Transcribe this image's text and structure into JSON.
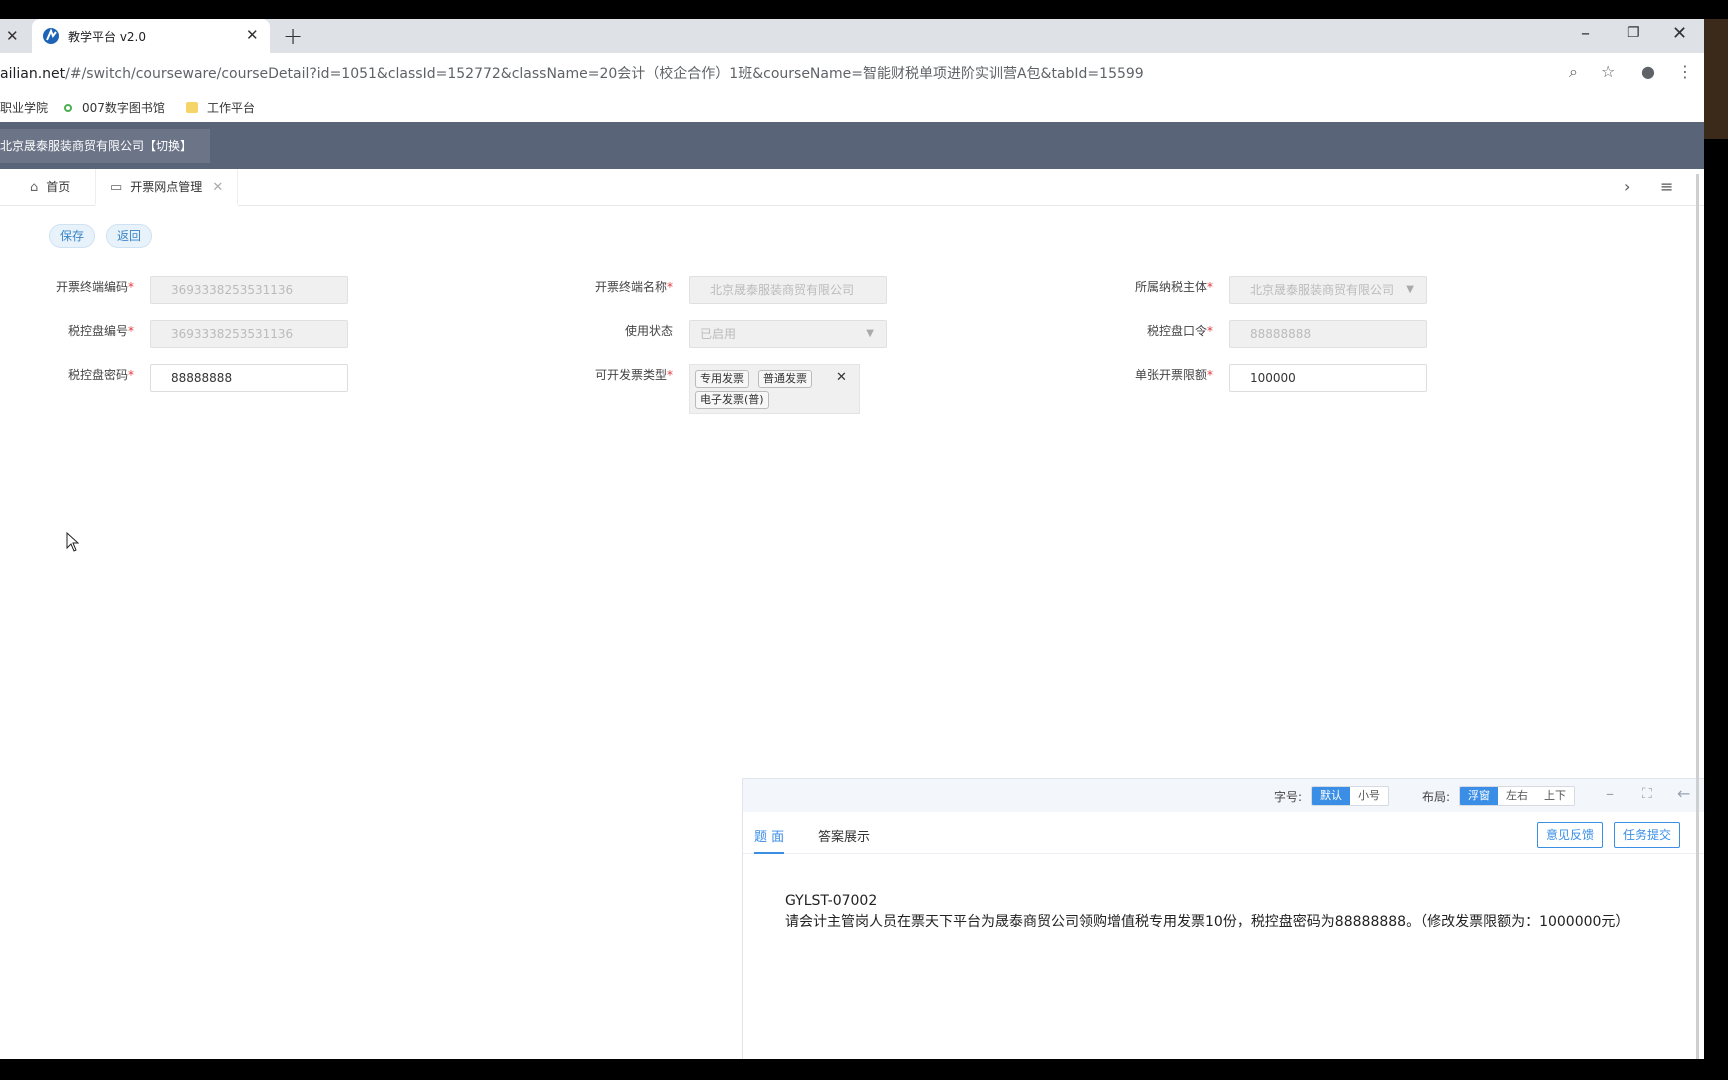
{
  "browser": {
    "tab_title": "教学平台 v2.0",
    "url_host": "ailian.net",
    "url_path": "/#/switch/courseware/courseDetail?id=1051&classId=152772&className=20会计（校企合作）1班&courseName=智能财税单项进阶实训营A包&tabId=15599",
    "bookmarks": [
      "职业学院",
      "007数字图书馆",
      "工作平台"
    ]
  },
  "header": {
    "company": "北京晟泰服装商贸有限公司【切换】"
  },
  "page_tabs": {
    "home": "首页",
    "active": "开票网点管理"
  },
  "actions": {
    "save": "保存",
    "back": "返回"
  },
  "form": {
    "terminal_code_label": "开票终端编码",
    "terminal_code_value": "3693338253531136",
    "terminal_name_label": "开票终端名称",
    "terminal_name_value": "北京晟泰服装商贸有限公司",
    "taxpayer_label": "所属纳税主体",
    "taxpayer_value": "北京晟泰服装商贸有限公司",
    "disk_no_label": "税控盘编号",
    "disk_no_value": "3693338253531136",
    "status_label": "使用状态",
    "status_value": "已启用",
    "disk_cmd_label": "税控盘口令",
    "disk_cmd_value": "88888888",
    "disk_pwd_label": "税控盘密码",
    "disk_pwd_value": "88888888",
    "invoice_types_label": "可开发票类型",
    "invoice_types": [
      "专用发票",
      "普通发票",
      "电子发票(普)"
    ],
    "limit_label": "单张开票限额",
    "limit_value": "100000"
  },
  "panel": {
    "font_label": "字号:",
    "font_options": [
      "默认",
      "小号"
    ],
    "layout_label": "布局:",
    "layout_options": [
      "浮窗",
      "左右",
      "上下"
    ],
    "tab_question": "题 面",
    "tab_answer": "答案展示",
    "feedback": "意见反馈",
    "submit": "任务提交",
    "question_code": "GYLST-07002",
    "question_text": "请会计主管岗人员在票天下平台为晟泰商贸公司领购增值税专用发票10份，税控盘密码为88888888。（修改发票限额为：1000000元）"
  }
}
